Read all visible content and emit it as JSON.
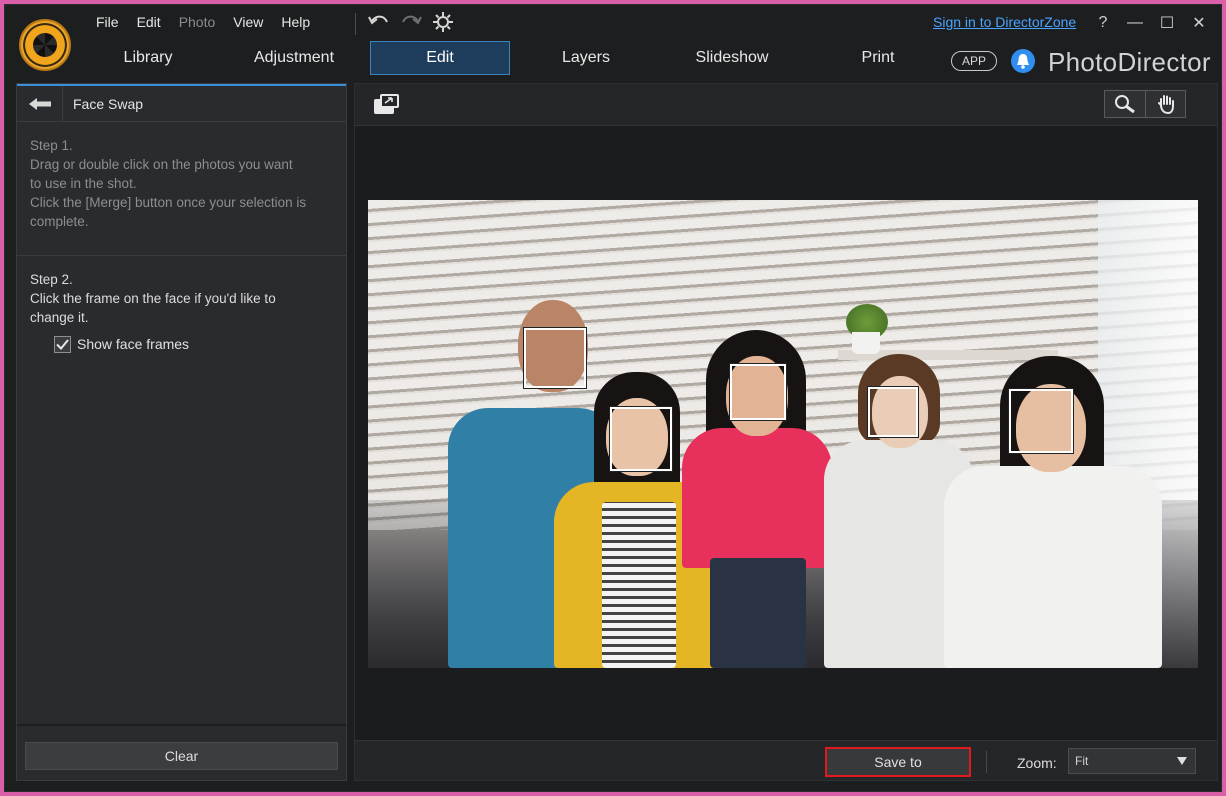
{
  "menu": {
    "file": "File",
    "edit": "Edit",
    "photo": "Photo",
    "view": "View",
    "help": "Help"
  },
  "signin": "Sign in to DirectorZone",
  "window_buttons": {
    "help": "?",
    "minimize": "—",
    "maximize": "☐",
    "close": "✕"
  },
  "modules": {
    "library": "Library",
    "adjustment": "Adjustment",
    "edit": "Edit",
    "layers": "Layers",
    "slideshow": "Slideshow",
    "print": "Print"
  },
  "app_badge": "APP",
  "brand": "PhotoDirector",
  "left_panel": {
    "title": "Face Swap",
    "step1_title": "Step 1.",
    "step1_line1": "Drag or double click on the photos you want",
    "step1_line2": "to use in the shot.",
    "step1_line3": "Click the [Merge] button once your selection is",
    "step1_line4": "complete.",
    "step2_title": "Step 2.",
    "step2_line1": "Click the frame on the face if you'd like to",
    "step2_line2": "change it.",
    "show_face_frames_label": "Show face frames",
    "show_face_frames_checked": true,
    "clear_label": "Clear"
  },
  "bottom": {
    "save_label": "Save to",
    "zoom_label": "Zoom:",
    "zoom_value": "Fit"
  },
  "icons": {
    "logo": "photodirector-logo-icon",
    "undo": "undo-icon",
    "redo": "redo-icon",
    "settings": "gear-icon",
    "bell": "bell-icon",
    "back": "back-arrow-icon",
    "fit": "fit-view-icon",
    "zoom": "magnifier-icon",
    "hand": "hand-pan-icon"
  },
  "colors": {
    "accent": "#3f83bd",
    "link": "#4aa3ff",
    "highlight_border": "#e01a1a",
    "background": "#1d1e20"
  }
}
